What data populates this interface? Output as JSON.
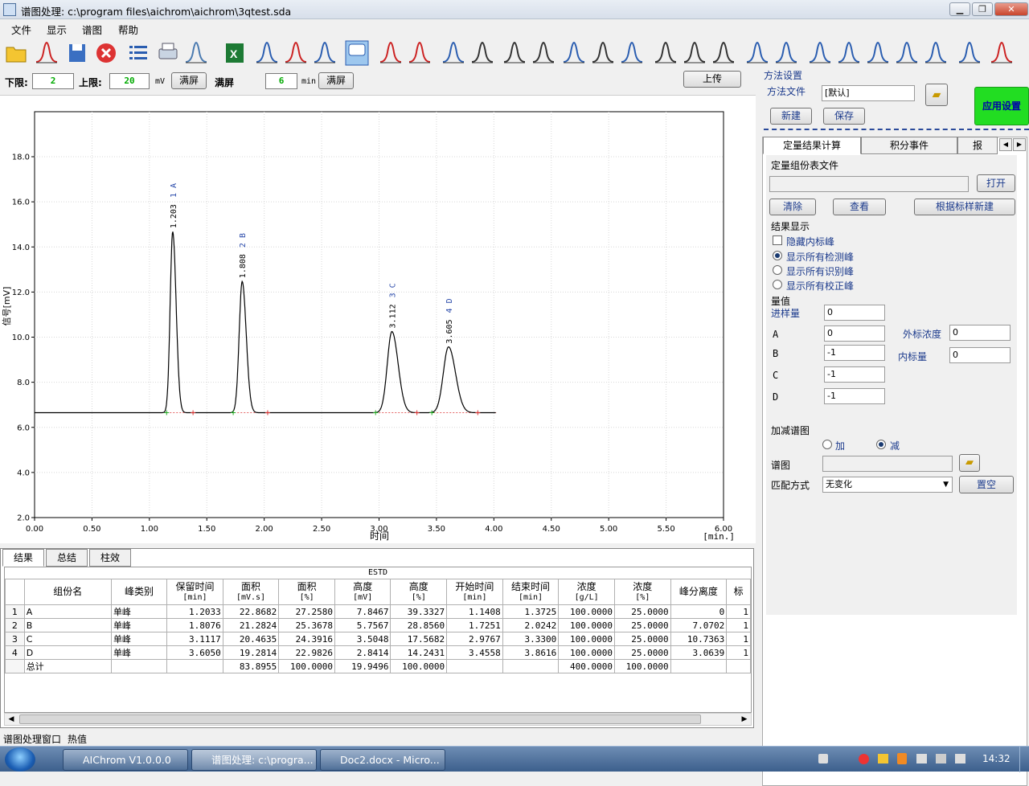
{
  "window": {
    "title": "谱图处理: c:\\program files\\aichrom\\aichrom\\3qtest.sda"
  },
  "menu": [
    "文件",
    "显示",
    "谱图",
    "帮助"
  ],
  "toolbar": {
    "icons": [
      "open-folder-icon",
      "waveform-icon",
      "save-icon",
      "close-red-icon",
      "list-icon",
      "print-icon",
      "print-preview-icon",
      "excel-icon",
      "baseline-icon",
      "delete-baseline-icon",
      "peak-icon",
      "comment-icon",
      "peak-split-icon",
      "peak-width-icon",
      "valley-icon",
      "inflection-icon",
      "peak-start-icon",
      "vertical-scale-icon",
      "negative-peak-icon",
      "add-peak-icon",
      "tangent-icon",
      "integrate-icon",
      "threshold-icon",
      "group-icon",
      "shoulder-icon",
      "multi-peak-icon",
      "skim-icon",
      "forced-peak-icon",
      "area-icon",
      "drop-icon",
      "smooth-icon",
      "fit-icon",
      "export-icon"
    ]
  },
  "range": {
    "lower_label": "下限:",
    "lower_value": "2",
    "upper_label": "上限:",
    "upper_value": "20",
    "unit_mv": "mV",
    "full_button": "满屏",
    "full_label": "满屏",
    "time_value": "6",
    "unit_min": "min",
    "full_button2": "满屏",
    "upload_button": "上传"
  },
  "chart_data": {
    "type": "line",
    "xlabel": "时间",
    "xunit": "[min.]",
    "ylabel": "信号[mV]",
    "xlim": [
      0,
      6
    ],
    "ylim": [
      2,
      20
    ],
    "xticks": [
      "0.00",
      "0.50",
      "1.00",
      "1.50",
      "2.00",
      "2.50",
      "3.00",
      "3.50",
      "4.00",
      "4.50",
      "5.00",
      "5.50",
      "6.00"
    ],
    "yticks": [
      "2.0",
      "4.0",
      "6.0",
      "8.0",
      "10.0",
      "12.0",
      "14.0",
      "16.0",
      "18.0"
    ],
    "baseline": 6.65,
    "peaks": [
      {
        "rt": 1.203,
        "height": 14.68,
        "sigma": 0.022,
        "label": "1.203  1  A"
      },
      {
        "rt": 1.808,
        "height": 12.47,
        "sigma": 0.026,
        "label": "1.808  2  B"
      },
      {
        "rt": 3.112,
        "height": 10.25,
        "sigma": 0.04,
        "label": "3.112  3  C"
      },
      {
        "rt": 3.605,
        "height": 9.57,
        "sigma": 0.045,
        "label": "3.605  4  D"
      }
    ],
    "signal_end": 4.02,
    "markers": [
      1.15,
      1.38,
      1.73,
      2.03,
      2.97,
      3.33,
      3.46,
      3.86
    ]
  },
  "results": {
    "tabs": [
      "结果",
      "总结",
      "柱效"
    ],
    "caption": "ESTD",
    "headers": [
      {
        "name": "组份名",
        "unit": ""
      },
      {
        "name": "峰类别",
        "unit": ""
      },
      {
        "name": "保留时间",
        "unit": "[min]"
      },
      {
        "name": "面积",
        "unit": "[mV.s]"
      },
      {
        "name": "面积",
        "unit": "[%]"
      },
      {
        "name": "高度",
        "unit": "[mV]"
      },
      {
        "name": "高度",
        "unit": "[%]"
      },
      {
        "name": "开始时间",
        "unit": "[min]"
      },
      {
        "name": "结束时间",
        "unit": "[min]"
      },
      {
        "name": "浓度",
        "unit": "[g/L]"
      },
      {
        "name": "浓度",
        "unit": "[%]"
      },
      {
        "name": "峰分离度",
        "unit": ""
      },
      {
        "name": "标",
        "unit": ""
      }
    ],
    "rows": [
      [
        "1",
        "A",
        "单峰",
        "1.2033",
        "22.8682",
        "27.2580",
        "7.8467",
        "39.3327",
        "1.1408",
        "1.3725",
        "100.0000",
        "25.0000",
        "0",
        "1"
      ],
      [
        "2",
        "B",
        "单峰",
        "1.8076",
        "21.2824",
        "25.3678",
        "5.7567",
        "28.8560",
        "1.7251",
        "2.0242",
        "100.0000",
        "25.0000",
        "7.0702",
        "1"
      ],
      [
        "3",
        "C",
        "单峰",
        "3.1117",
        "20.4635",
        "24.3916",
        "3.5048",
        "17.5682",
        "2.9767",
        "3.3300",
        "100.0000",
        "25.0000",
        "10.7363",
        "1"
      ],
      [
        "4",
        "D",
        "单峰",
        "3.6050",
        "19.2814",
        "22.9826",
        "2.8414",
        "14.2431",
        "3.4558",
        "3.8616",
        "100.0000",
        "25.0000",
        "3.0639",
        "1"
      ],
      [
        "",
        "总计",
        "",
        "",
        "83.8955",
        "100.0000",
        "19.9496",
        "100.0000",
        "",
        "",
        "400.0000",
        "100.0000",
        "",
        ""
      ]
    ]
  },
  "right": {
    "method_settings": "方法设置",
    "method_file_label": "方法文件",
    "method_file_value": "[默认]",
    "new_button": "新建",
    "save_button": "保存",
    "apply_button": "应用设置",
    "tabs": [
      "定量结果计算",
      "积分事件",
      "报"
    ],
    "quant_table_file": "定量组份表文件",
    "open_button": "打开",
    "clear_button": "清除",
    "view_button": "查看",
    "create_button": "根据标样新建",
    "result_display": "结果显示",
    "hide_internal": "隐藏内标峰",
    "show_options": [
      "显示所有检测峰",
      "显示所有识别峰",
      "显示所有校正峰"
    ],
    "selected_option": 0,
    "amount_title": "量值",
    "injection_label": "进样量",
    "injection_value": "0",
    "components": [
      {
        "name": "A",
        "value": "0"
      },
      {
        "name": "B",
        "value": "-1"
      },
      {
        "name": "C",
        "value": "-1"
      },
      {
        "name": "D",
        "value": "-1"
      }
    ],
    "ext_conc_label": "外标浓度",
    "ext_conc_value": "0",
    "int_amount_label": "内标量",
    "int_amount_value": "0",
    "addsub_title": "加减谱图",
    "add_label": "加",
    "sub_label": "减",
    "chromatogram_label": "谱图",
    "match_label": "匹配方式",
    "match_value": "无变化",
    "reset_button": "置空"
  },
  "status": {
    "text": "谱图处理窗口",
    "hotkey": "热值"
  },
  "taskbar": {
    "tasks": [
      "AIChrom  V1.0.0.0",
      "谱图处理: c:\\progra...",
      "Doc2.docx - Micro..."
    ],
    "clock": "14:32"
  }
}
